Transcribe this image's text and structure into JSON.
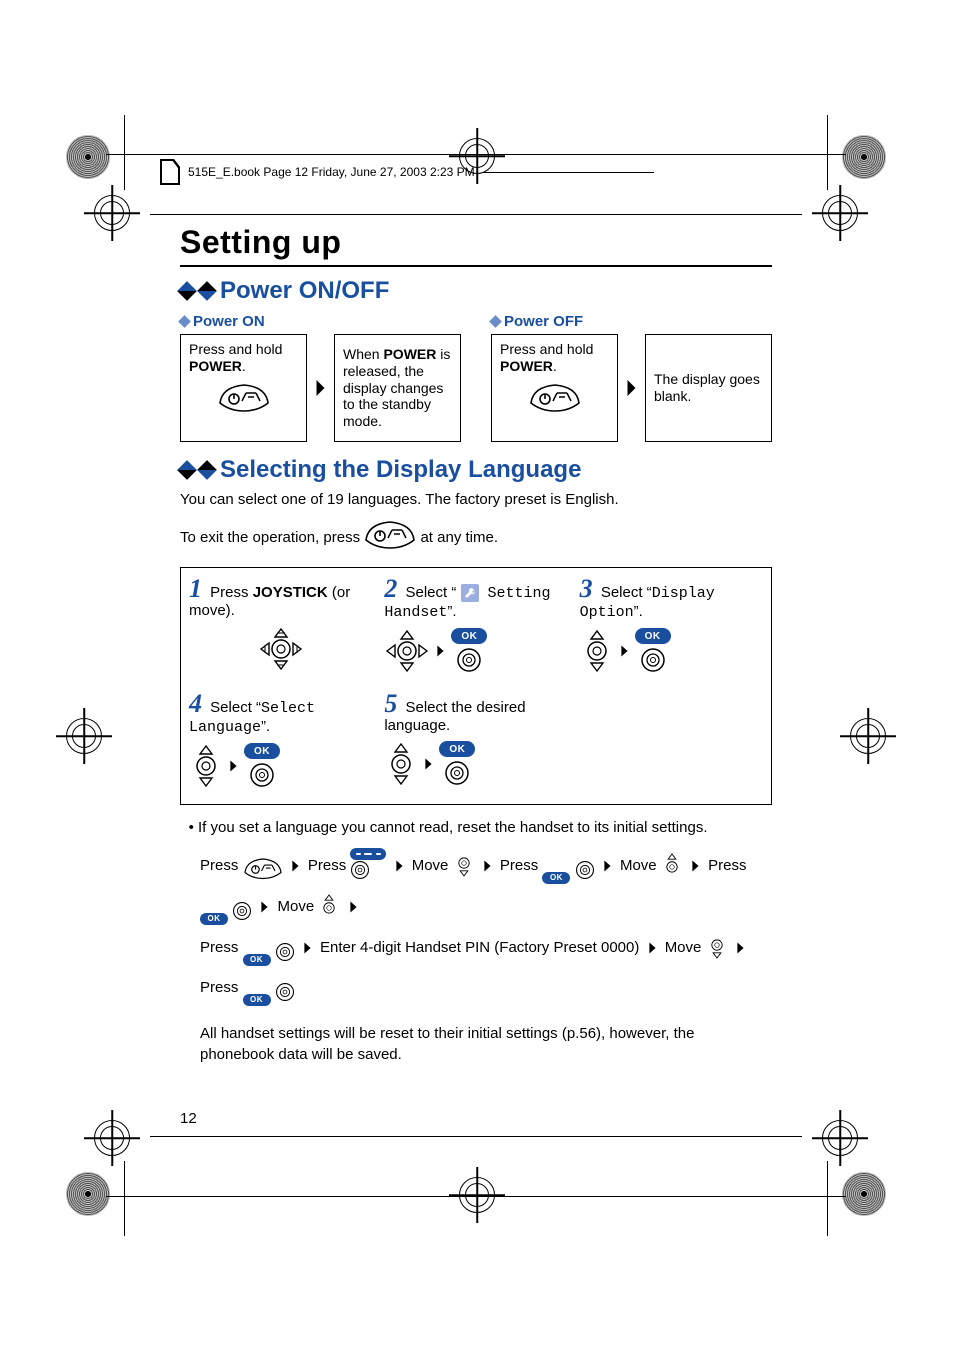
{
  "header": {
    "book_info": "515E_E.book  Page 12  Friday, June 27, 2003  2:23 PM"
  },
  "page": {
    "title": "Setting up",
    "number": "12"
  },
  "power": {
    "section_title": "Power ON/OFF",
    "on_label": "Power ON",
    "off_label": "Power OFF",
    "on_step1_a": "Press and hold ",
    "on_step1_key": "POWER",
    "on_step1_b": ".",
    "on_step2_a": "When ",
    "on_step2_key": "POWER",
    "on_step2_b": " is released, the display changes to the standby mode.",
    "off_step1_a": "Press and hold ",
    "off_step1_key": "POWER",
    "off_step1_b": ".",
    "off_step2": "The display goes blank."
  },
  "language": {
    "section_title": "Selecting the Display Language",
    "intro": "You can select one of 19 languages. The factory preset is English.",
    "exit_a": "To exit the operation, press ",
    "exit_b": " at any time.",
    "step1_a": "Press ",
    "step1_key": "JOYSTICK",
    "step1_b": " (or move).",
    "step2_a": "Select “",
    "step2_mono_top": " Setting ",
    "step2_mono_bot": "Handset",
    "step2_b": "”.",
    "step3_a": "Select “",
    "step3_mono_top": "Display ",
    "step3_mono_bot": "Option",
    "step3_b": "”.",
    "step4_a": "Select “",
    "step4_mono_top": "Select ",
    "step4_mono_bot": "Language",
    "step4_b": "”.",
    "step5": "Select the desired language.",
    "bullet": "If you set a language you cannot read, reset the handset to its initial settings.",
    "reset_seq": {
      "press": "Press ",
      "move": "Move ",
      "enter_pin": "Enter 4-digit Handset PIN (Factory Preset 0000)"
    },
    "reset_note": "All handset settings will be reset to their initial settings (p.56), however, the phonebook data will be saved."
  },
  "labels": {
    "ok": "OK"
  }
}
